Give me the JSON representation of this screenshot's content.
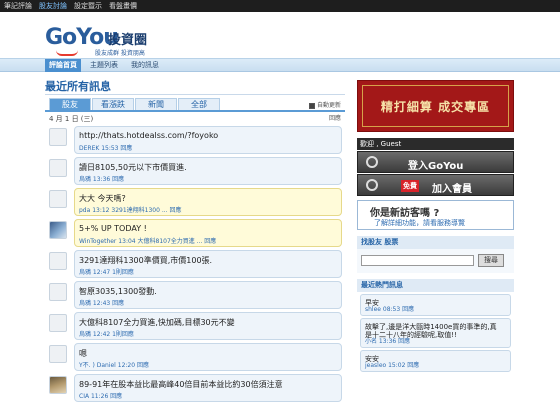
{
  "topbar": [
    "筆記評論",
    "股友討論",
    "設定暨示",
    "看盤畫價"
  ],
  "logo": {
    "main": "GoYou",
    "cn": "投資圈",
    "sub": "股友成群 投資朋高"
  },
  "nav": [
    "評論首頁",
    "主題列表",
    "我的訊息"
  ],
  "section_title": "最近所有訊息",
  "tabs": [
    "股友",
    "看漲跌",
    "新聞",
    "全部"
  ],
  "refresh_label": "自動更新",
  "date_label": "4 月 1 日 (三)",
  "back_label": "回應",
  "posts": [
    {
      "text": "http://thats.hotdealss.com/?foyoko",
      "meta": "DEREK  15:53  回應",
      "hl": false
    },
    {
      "text": "讀日8105,50元以下市價買進.",
      "meta": "烏鴉  13:36  回應",
      "hl": false
    },
    {
      "text": "大大 今天嗎?",
      "meta": "pda  13:12  3291達翔科1300 ...  回應",
      "hl": true
    },
    {
      "text": "5+% UP TODAY !",
      "meta": "WinTogether  13:04  大億科8107全力買進 ...  回應",
      "hl": true
    },
    {
      "text": "3291達翔科1300準價買,市價100張.",
      "meta": "烏鴉  12:47  1則回應",
      "hl": false
    },
    {
      "text": "智原3035,1300發動.",
      "meta": "烏鴉  12:43  回應",
      "hl": false
    },
    {
      "text": "大億科8107全力買進,快加碼,目標30元不變",
      "meta": "烏鴉  12:42  1則回應",
      "hl": false
    },
    {
      "text": "嗯",
      "meta": "Y不. ) Daniel  12:20  回應",
      "hl": false
    },
    {
      "text": "89-91年在股本益比最高峰40倍目前本益比約30倍須注意",
      "meta": "CIA  11:26  回應",
      "hl": false
    }
  ],
  "banner": "精打細算 成交專區",
  "welcome": "歡迎 , Guest",
  "login": "登入GoYou",
  "register_badge": "免費",
  "register": "加入會員",
  "newvisit": {
    "title": "你是新訪客嗎 ?",
    "sub": "了解詳細功能，請看服務導覽"
  },
  "find_friend": "找股友 股票",
  "search_btn": "搜尋",
  "hot_title": "最近熱門訊息",
  "hot": [
    {
      "t": "早安",
      "m": "shlee  08:53  回應"
    },
    {
      "t": "故擊了,邊是洋大甌時1400e買的事準的,真",
      "t2": "是十二十八年的經驗呢,取值!!",
      "m": "小名  13:36  回應"
    },
    {
      "t": "安安",
      "m": "jeasleo  15:02  回應"
    }
  ]
}
